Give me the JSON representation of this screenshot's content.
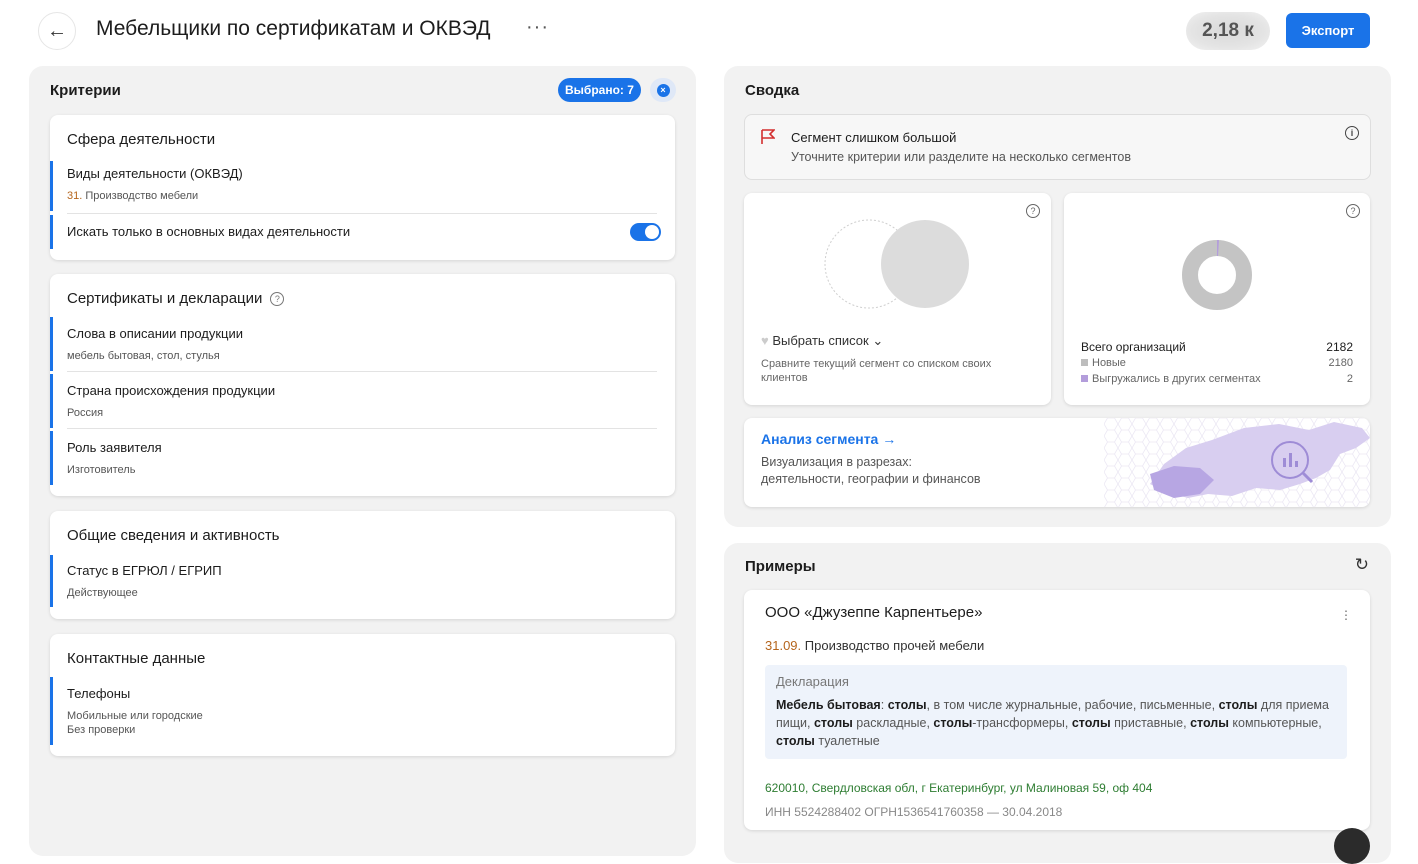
{
  "header": {
    "back_icon": "←",
    "title": "Мебельщики по сертификатам и ОКВЭД",
    "more_icon": "···",
    "count": "2,18 к",
    "export_label": "Экспорт"
  },
  "criteria": {
    "title": "Критерии",
    "selected_label": "Выбрано: 7",
    "clear_icon": "×",
    "groups": [
      {
        "title": "Сфера деятельности",
        "items": [
          {
            "name": "Виды деятельности (ОКВЭД)",
            "code": "31.",
            "value": "Производство мебели"
          },
          {
            "name": "Искать только в основных видах деятельности",
            "toggle": true
          }
        ]
      },
      {
        "title": "Сертификаты и декларации",
        "help": "?",
        "items": [
          {
            "name": "Слова в описании продукции",
            "value": "мебель бытовая, стол, стулья"
          },
          {
            "name": "Страна происхождения продукции",
            "value": "Россия"
          },
          {
            "name": "Роль заявителя",
            "value": "Изготовитель"
          }
        ]
      },
      {
        "title": "Общие сведения и активность",
        "items": [
          {
            "name": "Статус в ЕГРЮЛ / ЕГРИП",
            "value": "Действующее"
          }
        ]
      },
      {
        "title": "Контактные данные",
        "items": [
          {
            "name": "Телефоны",
            "value": "Мобильные или городские",
            "value2": "Без проверки"
          }
        ]
      }
    ]
  },
  "summary": {
    "title": "Сводка",
    "alert_title": "Сегмент слишком большой",
    "alert_sub": "Уточните критерии или разделите на несколько сегментов",
    "info_icon": "i",
    "help": "?",
    "compare": {
      "select_label": "Выбрать список",
      "chevron": "⌄",
      "description": "Сравните текущий сегмент со списком своих клиентов"
    },
    "stats": {
      "total_label": "Всего организаций",
      "total_value": "2182",
      "new_label": "Новые",
      "new_value": "2180",
      "exported_label": "Выгружались в других сегментах",
      "exported_value": "2",
      "colors": {
        "new": "#bdbdbd",
        "exported": "#b39ddb"
      }
    },
    "analysis": {
      "link": "Анализ сегмента →",
      "line1": "Визуализация в разрезах:",
      "line2": "деятельности, географии и финансов"
    }
  },
  "examples": {
    "title": "Примеры",
    "refresh_icon": "↻",
    "company": "ООО «Джузеппе Карпентьере»",
    "kebab": "⋮",
    "okved_code": "31.09.",
    "okved_name": "Производство прочей мебели",
    "decl_label": "Декларация",
    "address": "620010, Свердловская обл, г Екатеринбург, ул Малиновая 59, оф 404",
    "ids": "ИНН 5524288402   ОГРН1536541760358 — 30.04.2018"
  }
}
